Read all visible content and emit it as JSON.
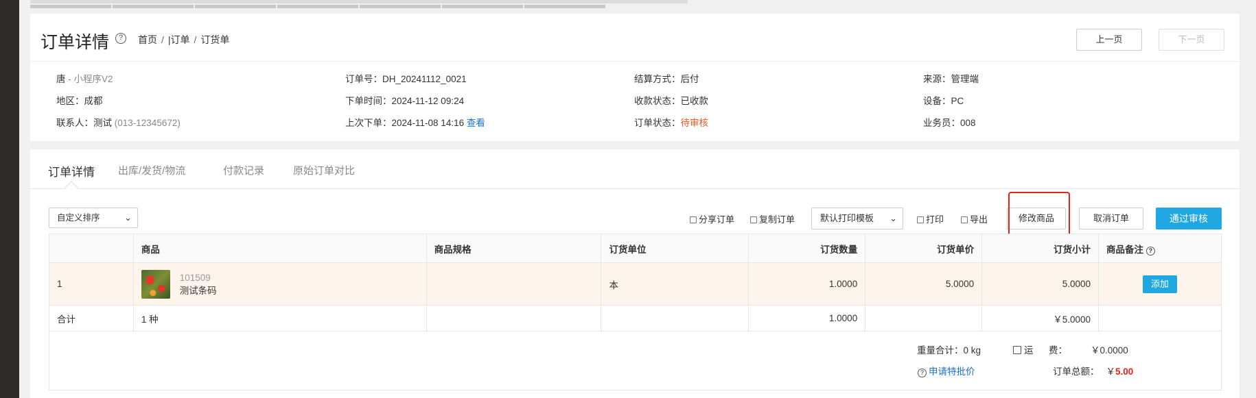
{
  "header": {
    "title": "订单详情",
    "breadcrumb": [
      "首页",
      "|订单",
      "订货单"
    ],
    "prev_label": "上一页",
    "next_label": "下一页"
  },
  "info": {
    "customer": "唐",
    "customer_sub": " - 小程序V2",
    "region_label": "地区：",
    "region": "成都",
    "contact_label": "联系人：",
    "contact": "测试",
    "contact_phone": "(013-12345672)",
    "order_no_label": "订单号：",
    "order_no": "DH_20241112_0021",
    "order_time_label": "下单时间：",
    "order_time": "2024-11-12 09:24",
    "last_order_label": "上次下单：",
    "last_order": "2024-11-08 14:16",
    "view_link": "查看",
    "settle_label": "结算方式：",
    "settle": "后付",
    "payment_label": "收款状态：",
    "payment": "已收款",
    "status_label": "订单状态：",
    "status": "待审核",
    "source_label": "来源：",
    "source": "管理端",
    "device_label": "设备：",
    "device": "PC",
    "salesman_label": "业务员：",
    "salesman": "008"
  },
  "tabs": [
    "订单详情",
    "出库/发货/物流",
    "付款记录",
    "原始订单对比"
  ],
  "toolbar": {
    "sort_select": "自定义排序",
    "share": "分享订单",
    "copy": "复制订单",
    "print_template": "默认打印模板",
    "print": "打印",
    "export": "导出",
    "edit_goods": "修改商品",
    "cancel_order": "取消订单",
    "approve": "通过审核"
  },
  "table": {
    "headers": [
      "",
      "商品",
      "商品规格",
      "订货单位",
      "订货数量",
      "订货单价",
      "订货小计",
      "商品备注"
    ],
    "row": {
      "index": "1",
      "code": "101509",
      "name": "测试条码",
      "spec": "",
      "unit": "本",
      "qty": "1.0000",
      "price": "5.0000",
      "subtotal": "5.0000",
      "remark_btn": "添加"
    },
    "sum": {
      "label": "合计",
      "kinds": "1 种",
      "qty": "1.0000",
      "subtotal": "￥5.0000"
    }
  },
  "summary": {
    "weight": "重量合计：0 kg",
    "freight_label": "运      费：",
    "freight": "￥0.0000",
    "special_price": "申请特批价",
    "total_label": "订单总额：",
    "total_currency": "￥",
    "total": "5.00"
  },
  "colors": {
    "accent": "#1ea7e0",
    "warning": "#f05a23",
    "highlight": "#e8201a"
  }
}
